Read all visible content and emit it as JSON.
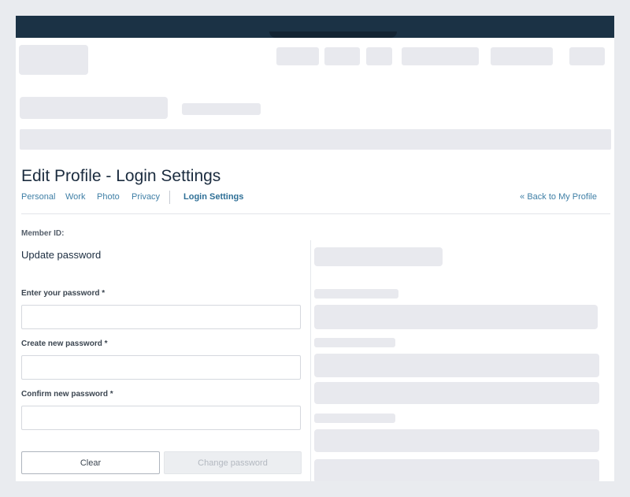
{
  "page": {
    "title": "Edit Profile - Login Settings"
  },
  "tabs": [
    {
      "label": "Personal",
      "active": false
    },
    {
      "label": "Work",
      "active": false
    },
    {
      "label": "Photo",
      "active": false
    },
    {
      "label": "Privacy",
      "active": false
    },
    {
      "label": "Login Settings",
      "active": true
    }
  ],
  "back_link": "« Back to My Profile",
  "member_id_label": "Member ID:",
  "form": {
    "title": "Update password",
    "fields": [
      {
        "label": "Enter your password *",
        "value": ""
      },
      {
        "label": "Create new password *",
        "value": ""
      },
      {
        "label": "Confirm new password *",
        "value": ""
      }
    ],
    "clear_label": "Clear",
    "submit_label": "Change password"
  },
  "colors": {
    "header_bar": "#1b3245",
    "link": "#3f7fa6",
    "skeleton": "#e8e9ee",
    "background": "#e9ebef"
  }
}
